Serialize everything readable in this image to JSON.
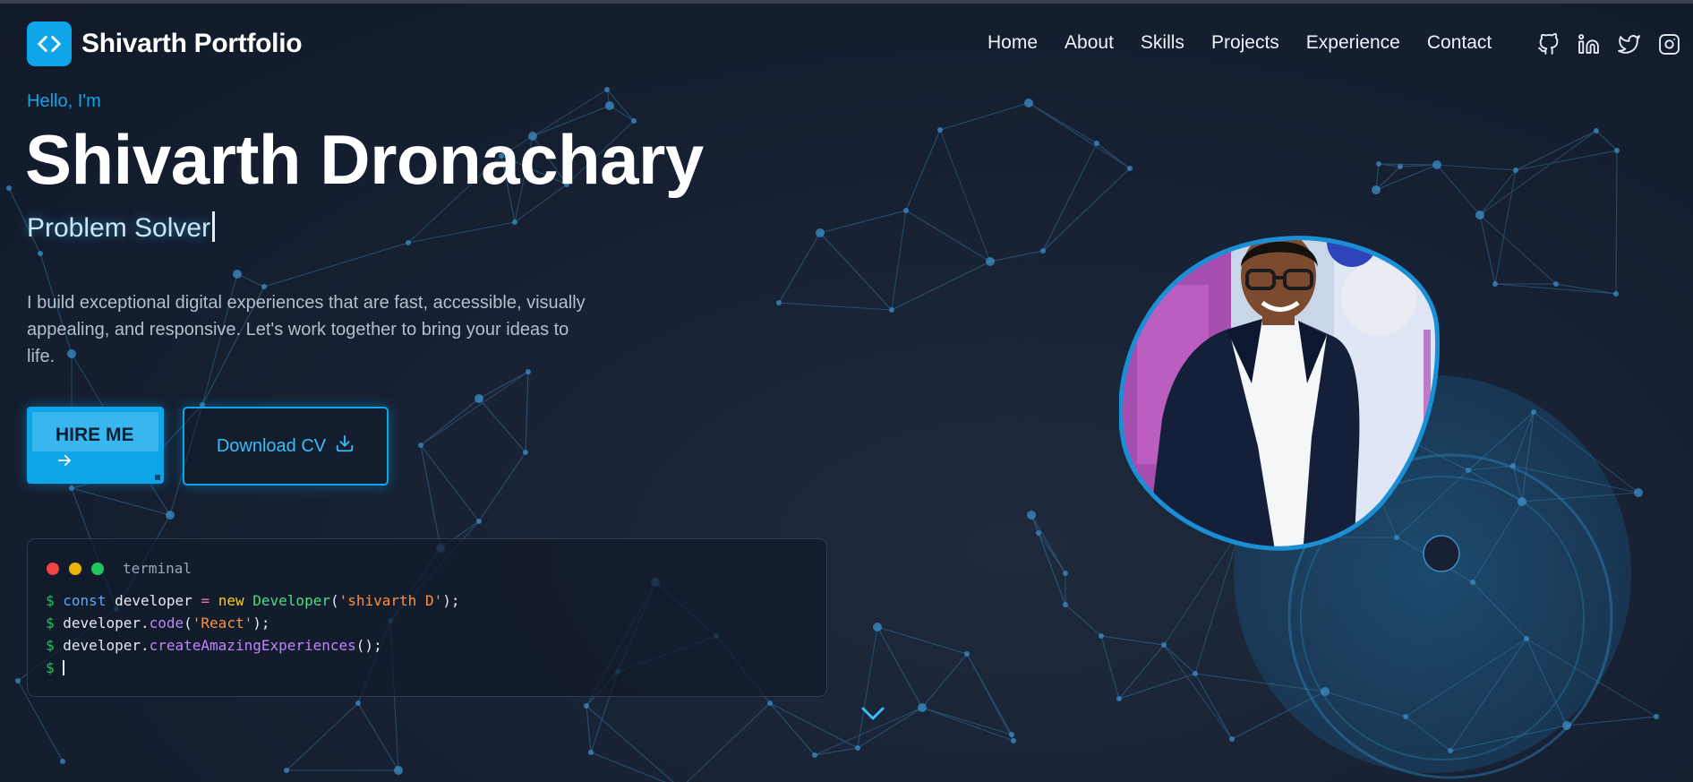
{
  "brand": {
    "name": "Shivarth Portfolio",
    "logo_icon": "code-brackets-icon"
  },
  "nav": {
    "items": [
      {
        "label": "Home"
      },
      {
        "label": "About"
      },
      {
        "label": "Skills"
      },
      {
        "label": "Projects"
      },
      {
        "label": "Experience"
      },
      {
        "label": "Contact"
      }
    ],
    "socials": [
      "github-icon",
      "linkedin-icon",
      "twitter-icon",
      "instagram-icon"
    ]
  },
  "hero": {
    "greeting": "Hello, I'm",
    "name": "Shivarth Dronachary",
    "role": "Problem Solver",
    "description": "I build exceptional digital experiences that are fast, accessible, visually appealing, and responsive. Let's work together to bring your ideas to life.",
    "hire_label": "HIRE ME",
    "cv_label": "Download CV"
  },
  "terminal": {
    "title": "terminal",
    "prompt": "$",
    "line1": {
      "kw": "const",
      "var": "developer",
      "op": "=",
      "new": "new",
      "cls": "Developer",
      "arg": "'shivarth D'",
      "end": ");"
    },
    "line2": {
      "obj": "developer.",
      "fn": "code",
      "arg": "'React'",
      "end": ");"
    },
    "line3": {
      "obj": "developer.",
      "fn": "createAmazingExperiences",
      "end": "();"
    }
  },
  "colors": {
    "accent": "#0ea5e9",
    "background": "#172133",
    "dot_red": "#ef4444",
    "dot_yellow": "#eab308",
    "dot_green": "#22c55e"
  }
}
